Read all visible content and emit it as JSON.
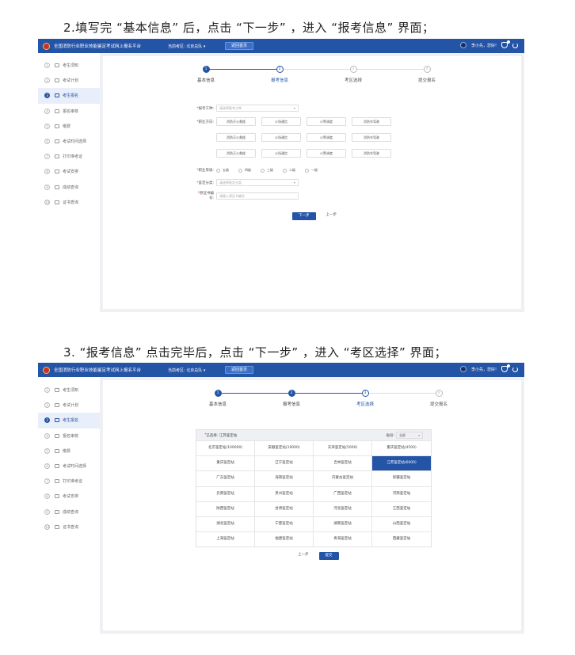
{
  "captions": {
    "first": "2.填写完 “基本信息” 后，点击 “下一步” ，进入 “报考信息” 界面；",
    "second": "3. “报考信息” 点击完毕后，点击 “下一步” ，进入 “考区选择” 界面；"
  },
  "topbar": {
    "title": "全国消防行业职业技能鉴定考试网上报名平台",
    "region": "当前考区: 北京总队 ▾",
    "home": "返回首页",
    "user": "李小先，您好!"
  },
  "sidebar": {
    "items": [
      {
        "num": "1",
        "label": "考生须知"
      },
      {
        "num": "2",
        "label": "考试计划"
      },
      {
        "num": "3",
        "label": "考生报名"
      },
      {
        "num": "4",
        "label": "报名审核"
      },
      {
        "num": "5",
        "label": "缴费"
      },
      {
        "num": "6",
        "label": "考试时间选择"
      },
      {
        "num": "7",
        "label": "打印准考证"
      },
      {
        "num": "8",
        "label": "考试安排"
      },
      {
        "num": "9",
        "label": "成绩查询"
      },
      {
        "num": "10",
        "label": "证书查询"
      }
    ]
  },
  "steps": [
    {
      "num": "1",
      "label": "基本信息"
    },
    {
      "num": "2",
      "label": "报考信息"
    },
    {
      "num": "3",
      "label": "考区选择"
    },
    {
      "num": "4",
      "label": "提交报名"
    }
  ],
  "form": {
    "job_label": "报考工种:",
    "job_placeholder": "请选择报考工种",
    "direction_label": "职业方向:",
    "directions": [
      [
        "消防灭火救援",
        "火场通信",
        "火警调度",
        "消防车驾驶"
      ],
      [
        "消防灭火救援",
        "火场通信",
        "火警调度",
        "消防车驾驶"
      ],
      [
        "消防灭火救援",
        "火场通信",
        "火警调度",
        "消防车驾驶"
      ]
    ],
    "level_label": "职业等级:",
    "levels": [
      "五级",
      "四级",
      "三级",
      "二级",
      "一级"
    ],
    "category_label": "鉴定分类:",
    "category_placeholder": "请选择鉴定分类",
    "cert_label": "原证书编号:",
    "cert_placeholder": "请输入原证书编号",
    "next": "下一步",
    "prev": "上一步"
  },
  "region": {
    "selected_label": "已选择:",
    "selected_value": "江苏鉴定站",
    "province_label": "省份:",
    "province_value": "全部",
    "stations": [
      "北京鉴定站(100000)",
      "安徽鉴定站(10000)",
      "天津鉴定站(5000)",
      "重庆鉴定站(4500)",
      "重庆鉴定站",
      "辽宁鉴定站",
      "吉林鉴定站",
      "江苏鉴定站(6000)",
      "广东鉴定站",
      "海南鉴定站",
      "内蒙古鉴定站",
      "新疆鉴定站",
      "云南鉴定站",
      "贵州鉴定站",
      "广西鉴定站",
      "河南鉴定站",
      "陕西鉴定站",
      "甘肃鉴定站",
      "河北鉴定站",
      "江西鉴定站",
      "湖北鉴定站",
      "宁夏鉴定站",
      "湖南鉴定站",
      "山西鉴定站",
      "上海鉴定站",
      "福建鉴定站",
      "青海鉴定站",
      "西藏鉴定站"
    ],
    "prev": "上一步",
    "submit": "提交"
  }
}
